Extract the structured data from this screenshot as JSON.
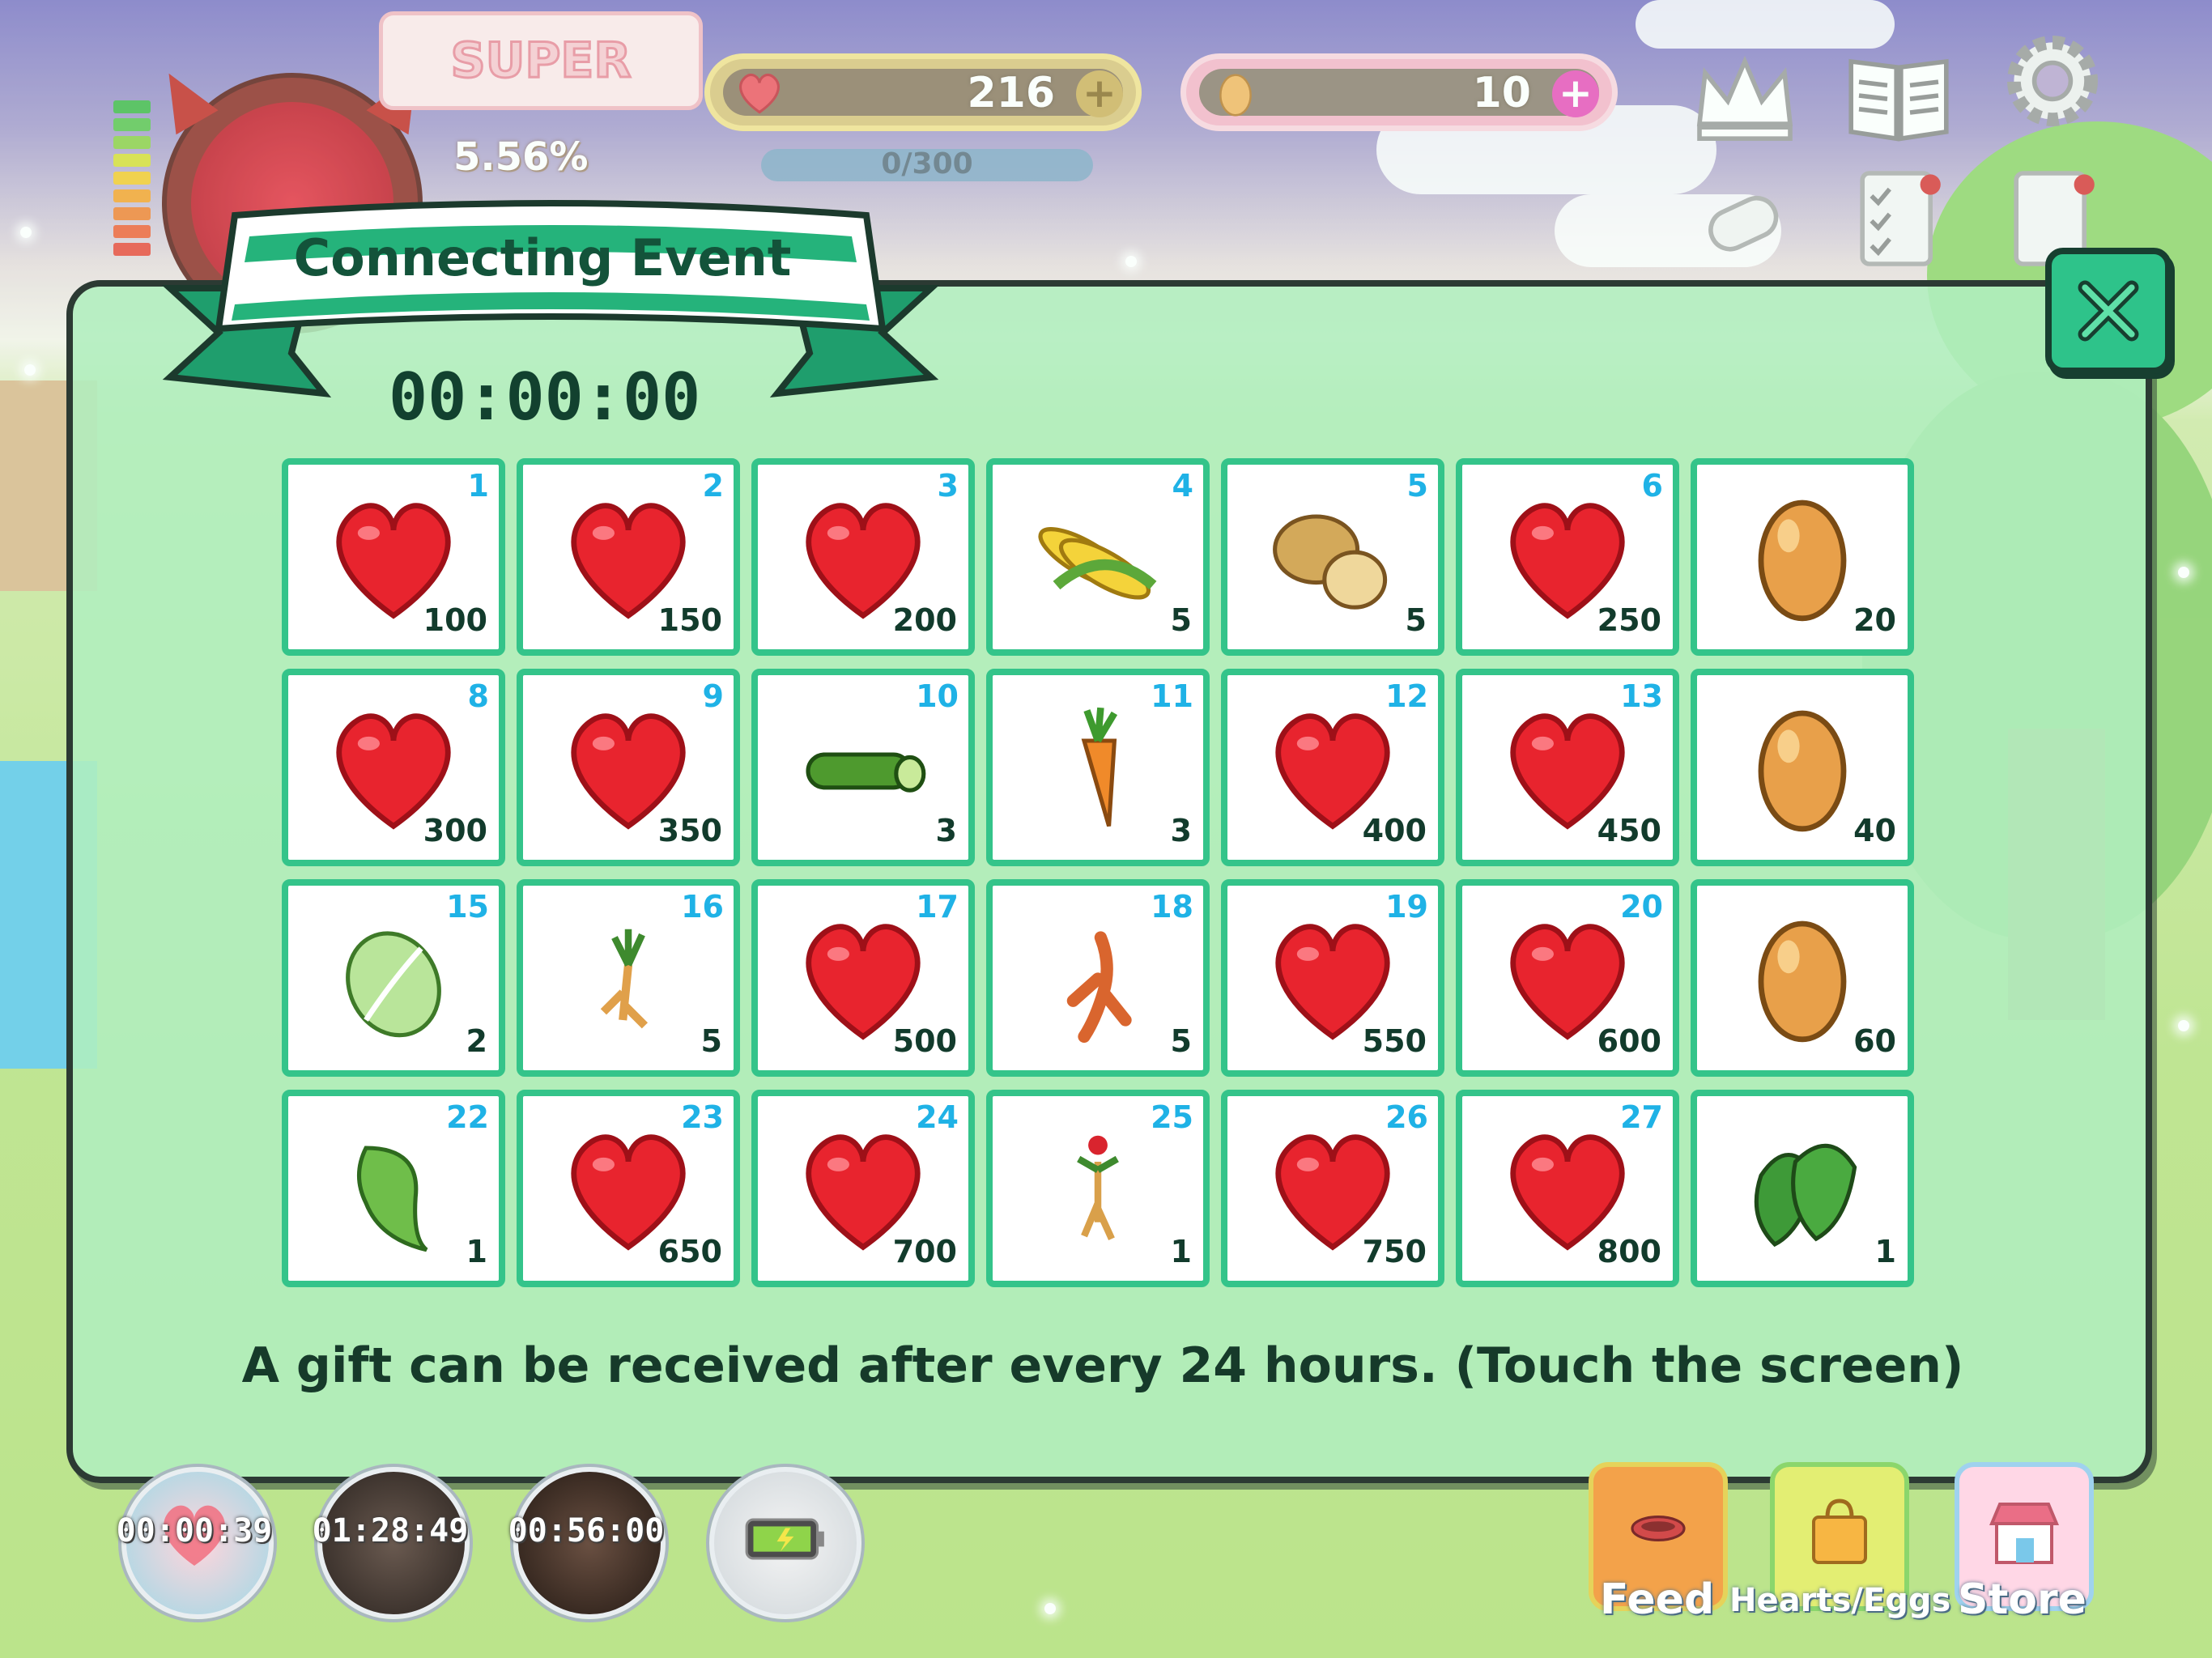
{
  "hud": {
    "status_badge": "SUPER",
    "growth_percent": "5.56%",
    "hearts_count": "216",
    "eggs_count": "10",
    "progress_text": "0/300",
    "progress_fraction": 0.0
  },
  "event": {
    "title": "Connecting Event",
    "countdown": "00:00:00",
    "footer_text": "A gift can be received after every 24 hours. (Touch the screen)",
    "rewards": [
      {
        "day": "1",
        "item": "heart",
        "amount": "100"
      },
      {
        "day": "2",
        "item": "heart",
        "amount": "150"
      },
      {
        "day": "3",
        "item": "heart",
        "amount": "200"
      },
      {
        "day": "4",
        "item": "corn",
        "amount": "5"
      },
      {
        "day": "5",
        "item": "potato",
        "amount": "5"
      },
      {
        "day": "6",
        "item": "heart",
        "amount": "250"
      },
      {
        "day": "",
        "item": "egg",
        "amount": "20"
      },
      {
        "day": "8",
        "item": "heart",
        "amount": "300"
      },
      {
        "day": "9",
        "item": "heart",
        "amount": "350"
      },
      {
        "day": "10",
        "item": "cucumber",
        "amount": "3"
      },
      {
        "day": "11",
        "item": "carrot",
        "amount": "3"
      },
      {
        "day": "12",
        "item": "heart",
        "amount": "400"
      },
      {
        "day": "13",
        "item": "heart",
        "amount": "450"
      },
      {
        "day": "",
        "item": "egg",
        "amount": "40"
      },
      {
        "day": "15",
        "item": "cabbage",
        "amount": "2"
      },
      {
        "day": "16",
        "item": "ginseng-small",
        "amount": "5"
      },
      {
        "day": "17",
        "item": "heart",
        "amount": "500"
      },
      {
        "day": "18",
        "item": "ginseng-red",
        "amount": "5"
      },
      {
        "day": "19",
        "item": "heart",
        "amount": "550"
      },
      {
        "day": "20",
        "item": "heart",
        "amount": "600"
      },
      {
        "day": "",
        "item": "egg",
        "amount": "60"
      },
      {
        "day": "22",
        "item": "lettuce",
        "amount": "1"
      },
      {
        "day": "23",
        "item": "heart",
        "amount": "650"
      },
      {
        "day": "24",
        "item": "heart",
        "amount": "700"
      },
      {
        "day": "25",
        "item": "ginseng-flower",
        "amount": "1"
      },
      {
        "day": "26",
        "item": "heart",
        "amount": "750"
      },
      {
        "day": "27",
        "item": "heart",
        "amount": "800"
      },
      {
        "day": "",
        "item": "leaves",
        "amount": "1"
      }
    ]
  },
  "timers": [
    {
      "label": "00:00:39",
      "icon": "heart-icon"
    },
    {
      "label": "01:28:49",
      "icon": "clock-icon"
    },
    {
      "label": "00:56:00",
      "icon": "clock-icon"
    },
    {
      "label": "",
      "icon": "battery-icon"
    }
  ],
  "shop": {
    "feed_label": "Feed",
    "hearts_eggs_label": "Hearts/Eggs",
    "store_label": "Store"
  },
  "colors": {
    "panel": "#b0eebe",
    "accent_green": "#34c48a",
    "day_number": "#1fb2e6",
    "heart_red": "#e8242e",
    "egg": "#e8a04a"
  }
}
